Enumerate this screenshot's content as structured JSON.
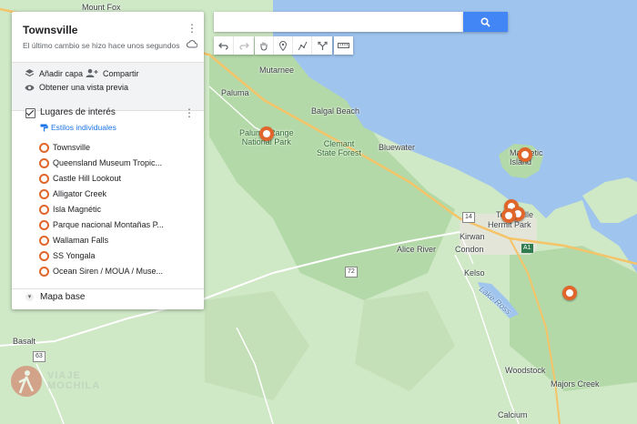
{
  "panel": {
    "title": "Townsville",
    "subtitle": "El último cambio se hizo hace unos segundos",
    "add_layer": "Añadir capa",
    "share": "Compartir",
    "preview": "Obtener una vista previa",
    "layer": {
      "title": "Lugares de interés",
      "styles_link": "Estilos individuales",
      "places": [
        "Townsville",
        "Queensland Museum Tropic...",
        "Castle Hill Lookout",
        "Alligator Creek",
        "Isla Magnétic",
        "Parque nacional Montañas P...",
        "Wallaman Falls",
        "SS Yongala",
        "Ocean Siren / MOUA / Muse..."
      ]
    },
    "base_map": "Mapa base"
  },
  "search": {
    "value": "",
    "placeholder": ""
  },
  "toolbar": {
    "icons": [
      "undo-icon",
      "redo-icon",
      "hand-icon",
      "marker-icon",
      "draw-line-icon",
      "directions-icon",
      "ruler-icon"
    ]
  },
  "map": {
    "labels": {
      "mount_fox": "Mount Fox",
      "mutarnee": "Mutarnee",
      "paluma": "Paluma",
      "balgal_beach": "Balgal Beach",
      "paluma_range_np": "Paluma Range\nNational Park",
      "clemant": "Clemant\nState Forest",
      "bluewater": "Bluewater",
      "magnetic": "Magnetic\nIsland",
      "townsville": "Townsville",
      "hermit_park": "Hermit Park",
      "kirwan": "Kirwan",
      "condon": "Condon",
      "alice_river": "Alice River",
      "kelso": "Kelso",
      "lake_ross": "Lake Ross",
      "woodstock": "Woodstock",
      "majors_creek": "Majors Creek",
      "basalt": "Basalt",
      "calcium": "Calcium",
      "highway_a1": "A1",
      "route_72": "72",
      "route_63": "63",
      "route_14": "14"
    }
  },
  "watermark": {
    "line1": "VIAJE",
    "line2": "MOCHILA"
  },
  "colors": {
    "land": "#cfe8c6",
    "forest": "#b4d9a8",
    "water": "#9fc4ee",
    "marker": "#e0662b",
    "accent": "#1a73e8",
    "search_button": "#4285f4"
  }
}
